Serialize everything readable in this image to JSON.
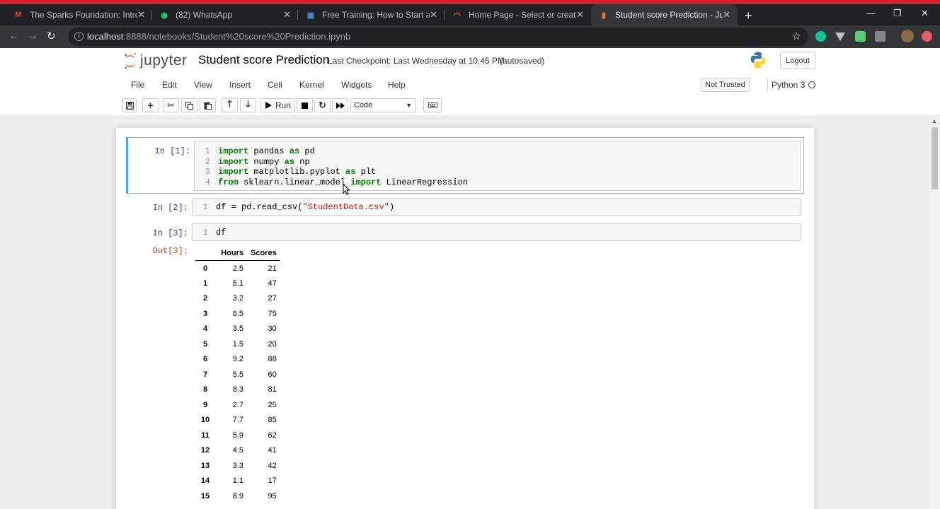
{
  "browser": {
    "tabs": [
      {
        "title": "The Sparks Foundation: Introduc",
        "favicon": "gmail-icon",
        "fav_label": "M",
        "fav_color": "#ea4335",
        "active": false
      },
      {
        "title": "(82) WhatsApp",
        "favicon": "whatsapp-icon",
        "fav_label": "◉",
        "fav_color": "#25d366",
        "active": false
      },
      {
        "title": "Free Training: How to Start a Suc",
        "favicon": "training-icon",
        "fav_label": "▣",
        "fav_color": "#4a90d9",
        "active": false
      },
      {
        "title": "Home Page - Select or create a n",
        "favicon": "jupyter-tab-icon",
        "fav_label": "◠",
        "fav_color": "#f37726",
        "active": false
      },
      {
        "title": "Student score Prediction - Jupyte",
        "favicon": "notebook-tab-icon",
        "fav_label": "▮",
        "fav_color": "#f37726",
        "active": true
      }
    ],
    "url_host": "localhost",
    "url_path": ":8888/notebooks/Student%20score%20Prediction.ipynb"
  },
  "header": {
    "brand": "jupyter",
    "notebook_name": "Student score Prediction",
    "checkpoint": "Last Checkpoint: Last Wednesday at 10:45 PM",
    "autosave": "(autosaved)",
    "logout_label": "Logout"
  },
  "menu": {
    "items": [
      "File",
      "Edit",
      "View",
      "Insert",
      "Cell",
      "Kernel",
      "Widgets",
      "Help"
    ],
    "trust_label": "Not Trusted",
    "kernel_name": "Python 3"
  },
  "toolbar": {
    "run_label": "Run",
    "cell_type": "Code"
  },
  "cells": [
    {
      "prompt": "In [1]:",
      "lines": [
        {
          "n": "1",
          "parts": [
            [
              "kw",
              "import"
            ],
            [
              "",
              " pandas "
            ],
            [
              "kw",
              "as"
            ],
            [
              "",
              " pd"
            ]
          ]
        },
        {
          "n": "2",
          "parts": [
            [
              "kw",
              "import"
            ],
            [
              "",
              " numpy "
            ],
            [
              "kw",
              "as"
            ],
            [
              "",
              " np"
            ]
          ]
        },
        {
          "n": "3",
          "parts": [
            [
              "kw",
              "import"
            ],
            [
              "",
              " matplotlib.pyplot "
            ],
            [
              "kw",
              "as"
            ],
            [
              "",
              " plt"
            ]
          ]
        },
        {
          "n": "4",
          "parts": [
            [
              "kw",
              "from"
            ],
            [
              "",
              " sklearn.linear_model "
            ],
            [
              "kw",
              "import"
            ],
            [
              "",
              " LinearRegression"
            ]
          ]
        }
      ]
    },
    {
      "prompt": "In [2]:",
      "lines": [
        {
          "n": "1",
          "parts": [
            [
              "",
              "df = pd.read_csv("
            ],
            [
              "str",
              "\"StudentData.csv\""
            ],
            [
              "",
              ")"
            ]
          ]
        }
      ]
    },
    {
      "prompt": "In [3]:",
      "lines": [
        {
          "n": "1",
          "parts": [
            [
              "",
              "df"
            ]
          ]
        }
      ]
    }
  ],
  "output": {
    "prompt": "Out[3]:",
    "columns": [
      "Hours",
      "Scores"
    ],
    "rows": [
      [
        "0",
        "2.5",
        "21"
      ],
      [
        "1",
        "5.1",
        "47"
      ],
      [
        "2",
        "3.2",
        "27"
      ],
      [
        "3",
        "8.5",
        "75"
      ],
      [
        "4",
        "3.5",
        "30"
      ],
      [
        "5",
        "1.5",
        "20"
      ],
      [
        "6",
        "9.2",
        "88"
      ],
      [
        "7",
        "5.5",
        "60"
      ],
      [
        "8",
        "8.3",
        "81"
      ],
      [
        "9",
        "2.7",
        "25"
      ],
      [
        "10",
        "7.7",
        "85"
      ],
      [
        "11",
        "5.9",
        "62"
      ],
      [
        "12",
        "4.5",
        "41"
      ],
      [
        "13",
        "3.3",
        "42"
      ],
      [
        "14",
        "1.1",
        "17"
      ],
      [
        "15",
        "8.9",
        "95"
      ]
    ]
  },
  "colors": {
    "accent_selected": "#42a5f5",
    "in_prompt": "#303f9f",
    "out_prompt": "#d84315"
  }
}
